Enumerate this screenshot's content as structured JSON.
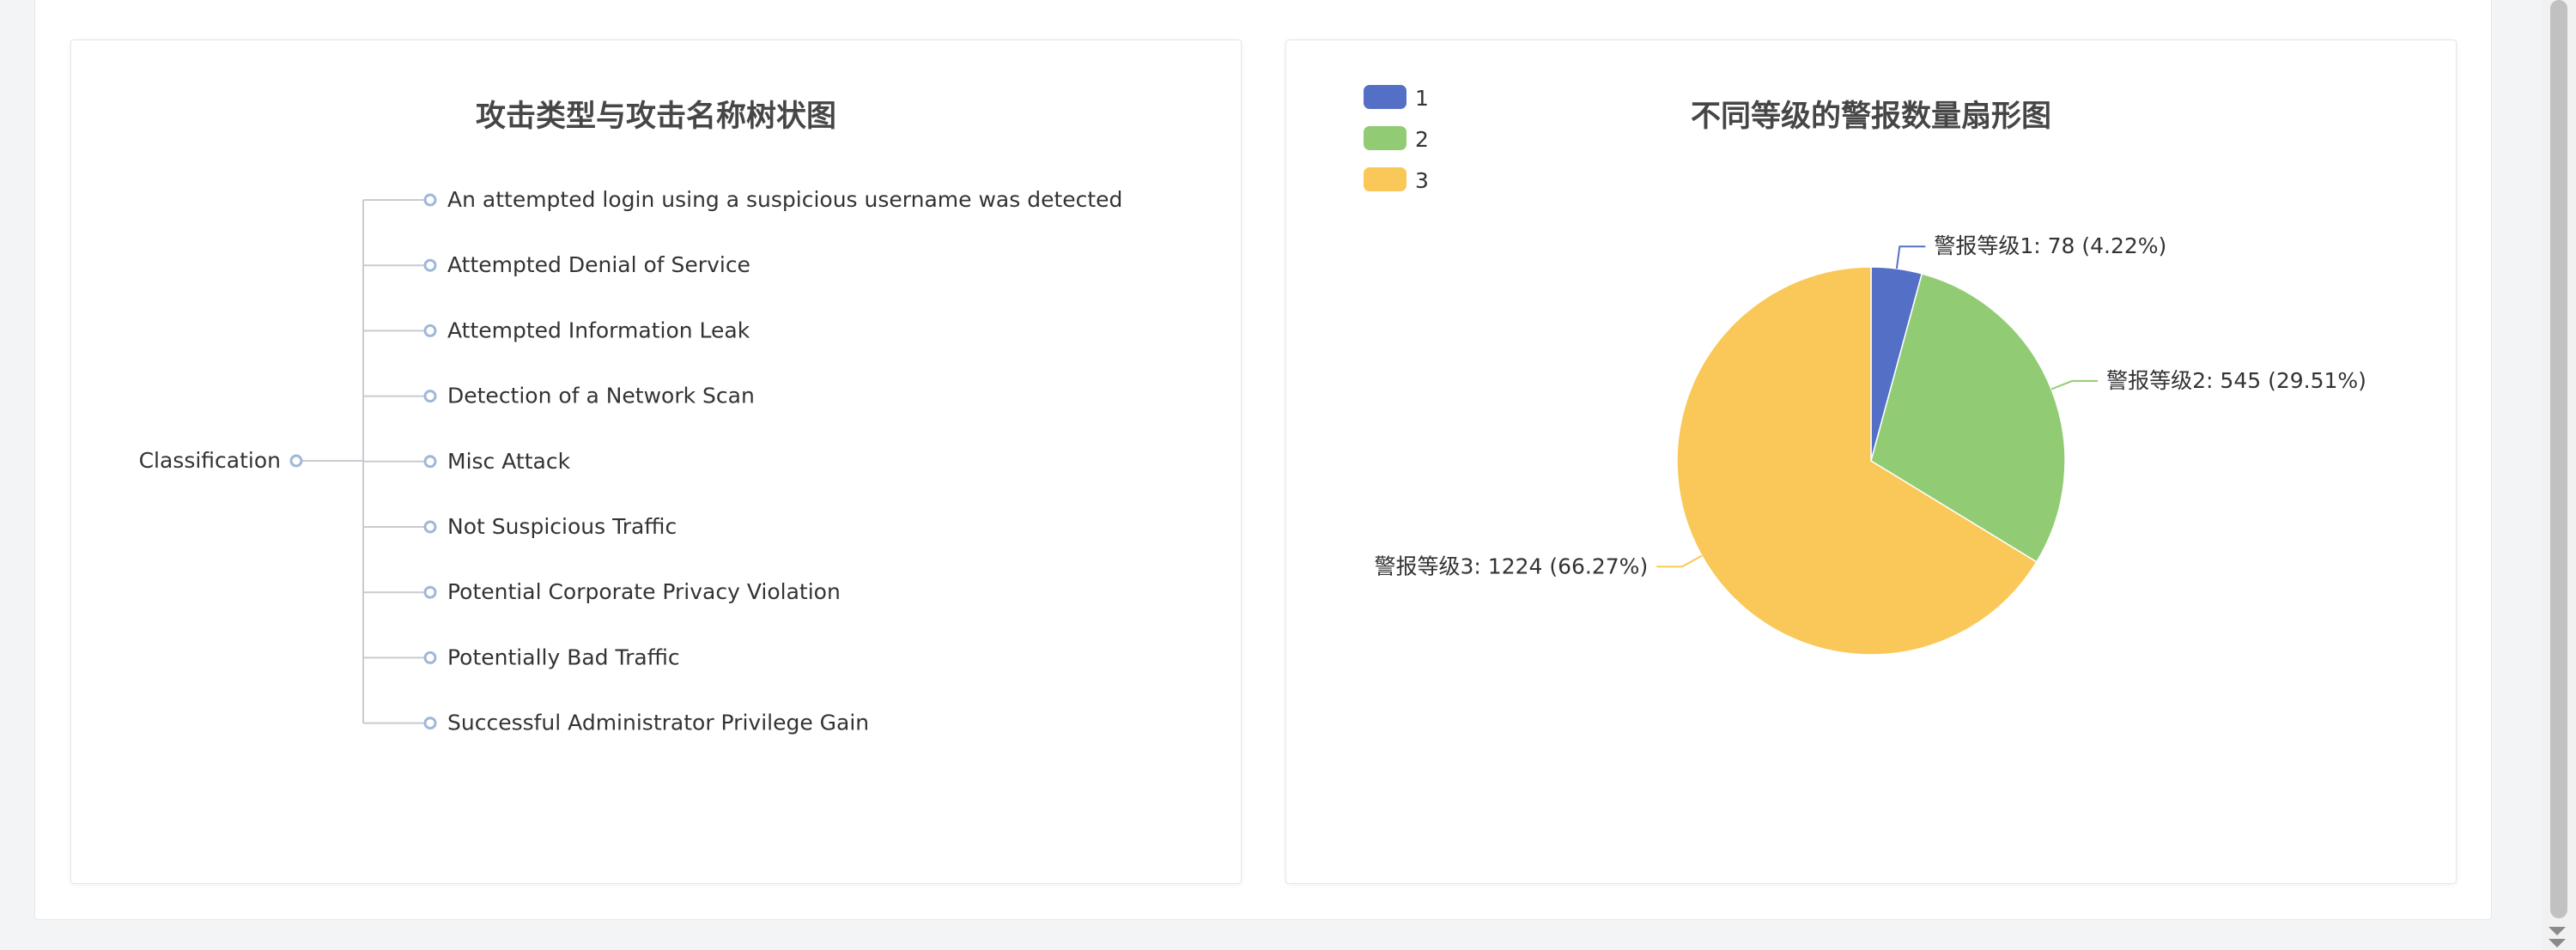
{
  "tree_chart": {
    "title": "攻击类型与攻击名称树状图",
    "root": "Classification",
    "children": [
      "An attempted login using a suspicious username was detected",
      "Attempted Denial of Service",
      "Attempted Information Leak",
      "Detection of a Network Scan",
      "Misc Attack",
      "Not Suspicious Traffic",
      "Potential Corporate Privacy Violation",
      "Potentially Bad Traffic",
      "Successful Administrator Privilege Gain"
    ],
    "line_color": "#c8cbd0",
    "node_color": "#9fb8d8"
  },
  "chart_data": {
    "type": "pie",
    "title": "不同等级的警报数量扇形图",
    "legend_position": "top-left",
    "series": [
      {
        "name": "1",
        "value": 78,
        "label": "警报等级1: 78 (4.22%)",
        "color": "#5470c6"
      },
      {
        "name": "2",
        "value": 545,
        "label": "警报等级2: 545 (29.51%)",
        "color": "#91cc75"
      },
      {
        "name": "3",
        "value": 1224,
        "label": "警报等级3: 1224 (66.27%)",
        "color": "#fac858"
      }
    ]
  }
}
